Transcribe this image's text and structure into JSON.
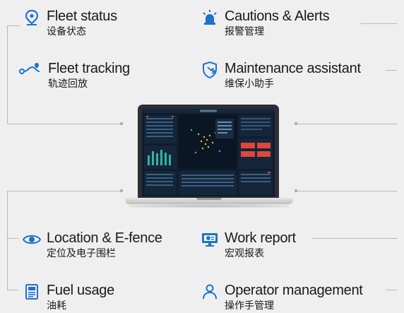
{
  "features": [
    {
      "id": "fleet-status",
      "en": "Fleet status",
      "zh": "设备状态",
      "icon": "location-pin-icon"
    },
    {
      "id": "fleet-tracking",
      "en": "Fleet tracking",
      "zh": "轨迹回放",
      "icon": "route-icon"
    },
    {
      "id": "cautions-alerts",
      "en": "Cautions & Alerts",
      "zh": "报警管理",
      "icon": "alarm-beacon-icon"
    },
    {
      "id": "maintenance-assistant",
      "en": "Maintenance assistant",
      "zh": "维保小助手",
      "icon": "wrench-shield-icon"
    },
    {
      "id": "location-efence",
      "en": "Location & E-fence",
      "zh": "定位及电子围栏",
      "icon": "eye-icon"
    },
    {
      "id": "fuel-usage",
      "en": "Fuel usage",
      "zh": "油耗",
      "icon": "fuel-gauge-icon"
    },
    {
      "id": "work-report",
      "en": "Work report",
      "zh": "宏观报表",
      "icon": "monitor-chart-icon"
    },
    {
      "id": "operator-management",
      "en": "Operator management",
      "zh": "操作手管理",
      "icon": "operators-icon"
    }
  ],
  "colors": {
    "accent": "#1e73c8",
    "background": "#efefef",
    "text": "#1a1a1a",
    "connector": "#b8b8b8"
  }
}
